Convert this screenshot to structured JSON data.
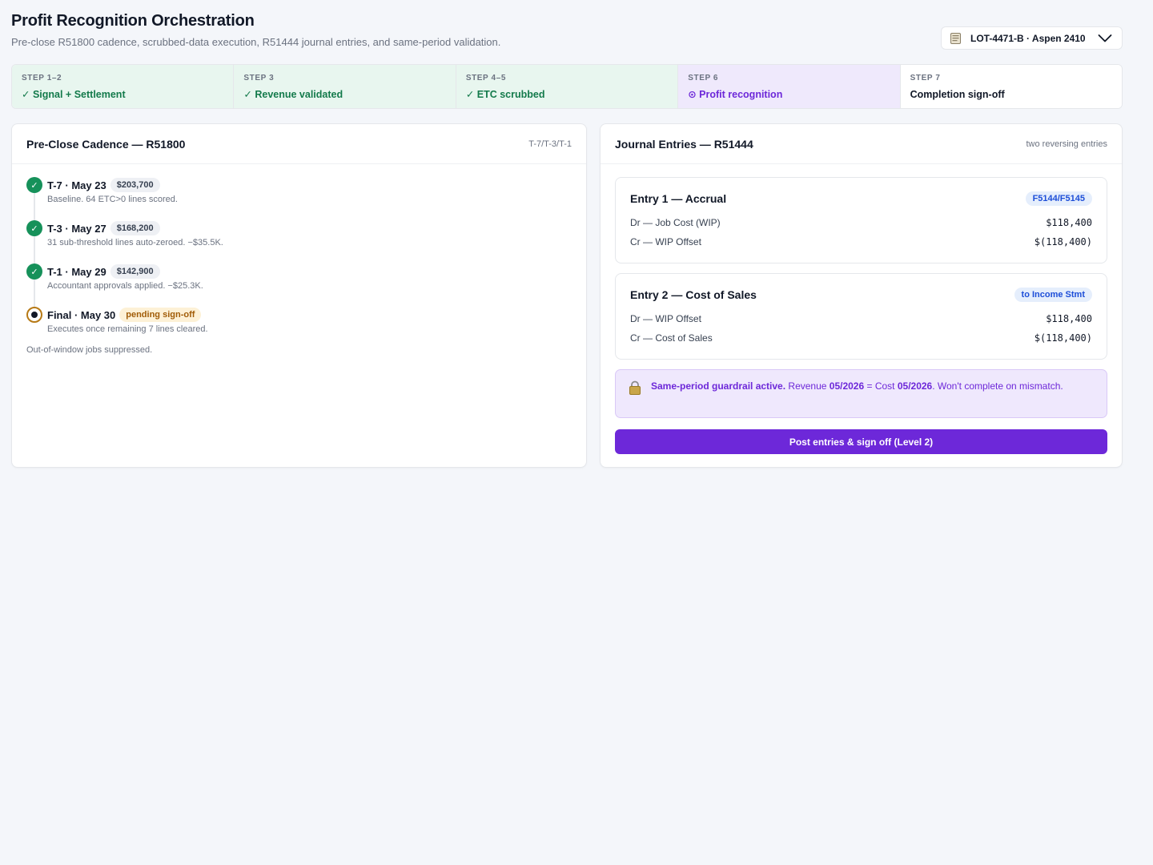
{
  "header": {
    "title": "Profit Recognition Orchestration",
    "subtitle": "Pre-close R51800 cadence, scrubbed-data execution, R51444 journal entries, and same-period validation.",
    "lot_selector": {
      "icon": "document-icon",
      "value": "LOT-4471-B · Aspen 2410",
      "chevron": "chevron-down-icon"
    }
  },
  "stepper": [
    {
      "num": "STEP 1–2",
      "label": "✓ Signal + Settlement",
      "state": "done"
    },
    {
      "num": "STEP 3",
      "label": "✓ Revenue validated",
      "state": "done"
    },
    {
      "num": "STEP 4–5",
      "label": "✓ ETC scrubbed",
      "state": "done"
    },
    {
      "num": "STEP 6",
      "label": "⊙ Profit recognition",
      "state": "active"
    },
    {
      "num": "STEP 7",
      "label": "Completion sign-off",
      "state": "todo"
    }
  ],
  "cadence": {
    "title": "Pre-Close Cadence — R51800",
    "meta": "T-7/T-3/T-1",
    "items": [
      {
        "label": "T-7 · May 23",
        "chip": "$203,700",
        "note": "Baseline. 64 ETC>0 lines scored.",
        "state": "done"
      },
      {
        "label": "T-3 · May 27",
        "chip": "$168,200",
        "note": "31 sub-threshold lines auto-zeroed. −$35.5K.",
        "state": "done"
      },
      {
        "label": "T-1 · May 29",
        "chip": "$142,900",
        "note": "Accountant approvals applied. −$25.3K.",
        "state": "done"
      },
      {
        "label": "Final · May 30",
        "chip": "pending sign-off",
        "note": "Executes once remaining 7 lines cleared.",
        "state": "pending"
      }
    ],
    "footer": "Out-of-window jobs suppressed.",
    "check_glyph": "✓"
  },
  "journal": {
    "title": "Journal Entries — R51444",
    "meta": "two reversing entries",
    "entries": [
      {
        "title": "Entry 1 — Accrual",
        "badge": "F5144/F5145",
        "lines": [
          {
            "account": "Dr — Job Cost (WIP)",
            "amount": "$118,400"
          },
          {
            "account": "Cr — WIP Offset",
            "amount": "$(118,400)"
          }
        ]
      },
      {
        "title": "Entry 2 — Cost of Sales",
        "badge": "to Income Stmt",
        "lines": [
          {
            "account": "Dr — WIP Offset",
            "amount": "$118,400"
          },
          {
            "account": "Cr — Cost of Sales",
            "amount": "$(118,400)"
          }
        ]
      }
    ],
    "guardrail": {
      "icon": "lock-icon",
      "lead": "Same-period guardrail active.",
      "t1": " Revenue ",
      "rev_period": "05/2026",
      "t2": " = Cost ",
      "cost_period": "05/2026",
      "t3": ". Won't complete on mismatch."
    },
    "post_button": "Post entries & sign off (Level 2)"
  },
  "colors": {
    "accent": "#6d28d9",
    "success": "#16915a",
    "warning": "#b77a16",
    "badge_blue": "#1d4ed8"
  }
}
